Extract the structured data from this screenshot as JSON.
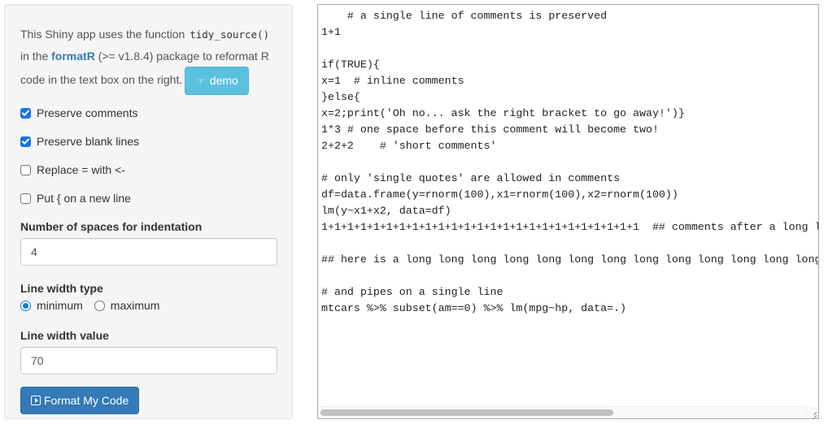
{
  "sidebar": {
    "intro": {
      "text_before_code": "This Shiny app uses the function ",
      "code": "tidy_source()",
      "text_in_the": " in the ",
      "link": "formatR",
      "text_after_link": " (>= v1.8.4) package to reformat R code in the text box on the right.",
      "demo_button": "demo",
      "demo_icon": "hand-point-right-icon"
    },
    "checkboxes": [
      {
        "label": "Preserve comments",
        "checked": true
      },
      {
        "label": "Preserve blank lines",
        "checked": true
      },
      {
        "label": "Replace = with <-",
        "checked": false
      },
      {
        "label": "Put { on a new line",
        "checked": false
      }
    ],
    "indent": {
      "label": "Number of spaces for indentation",
      "value": "4"
    },
    "width_type": {
      "label": "Line width type",
      "options": [
        {
          "label": "minimum",
          "selected": true
        },
        {
          "label": "maximum",
          "selected": false
        }
      ]
    },
    "width_value": {
      "label": "Line width value",
      "value": "70"
    },
    "format_button": "Format My Code",
    "format_icon": "play-square-icon"
  },
  "editor": {
    "code": "    # a single line of comments is preserved\n1+1\n\nif(TRUE){\nx=1  # inline comments\n}else{\nx=2;print('Oh no... ask the right bracket to go away!')}\n1*3 # one space before this comment will become two!\n2+2+2    # 'short comments'\n\n# only 'single quotes' are allowed in comments\ndf=data.frame(y=rnorm(100),x1=rnorm(100),x2=rnorm(100))\nlm(y~x1+x2, data=df)\n1+1+1+1+1+1+1+1+1+1+1+1+1+1+1+1+1+1+1+1+1+1+1+1+1  ## comments after a long line\n\n## here is a long long long long long long long long long long long long long comment\n\n# and pipes on a single line\nmtcars %>% subset(am==0) %>% lm(mpg~hp, data=.)"
  }
}
